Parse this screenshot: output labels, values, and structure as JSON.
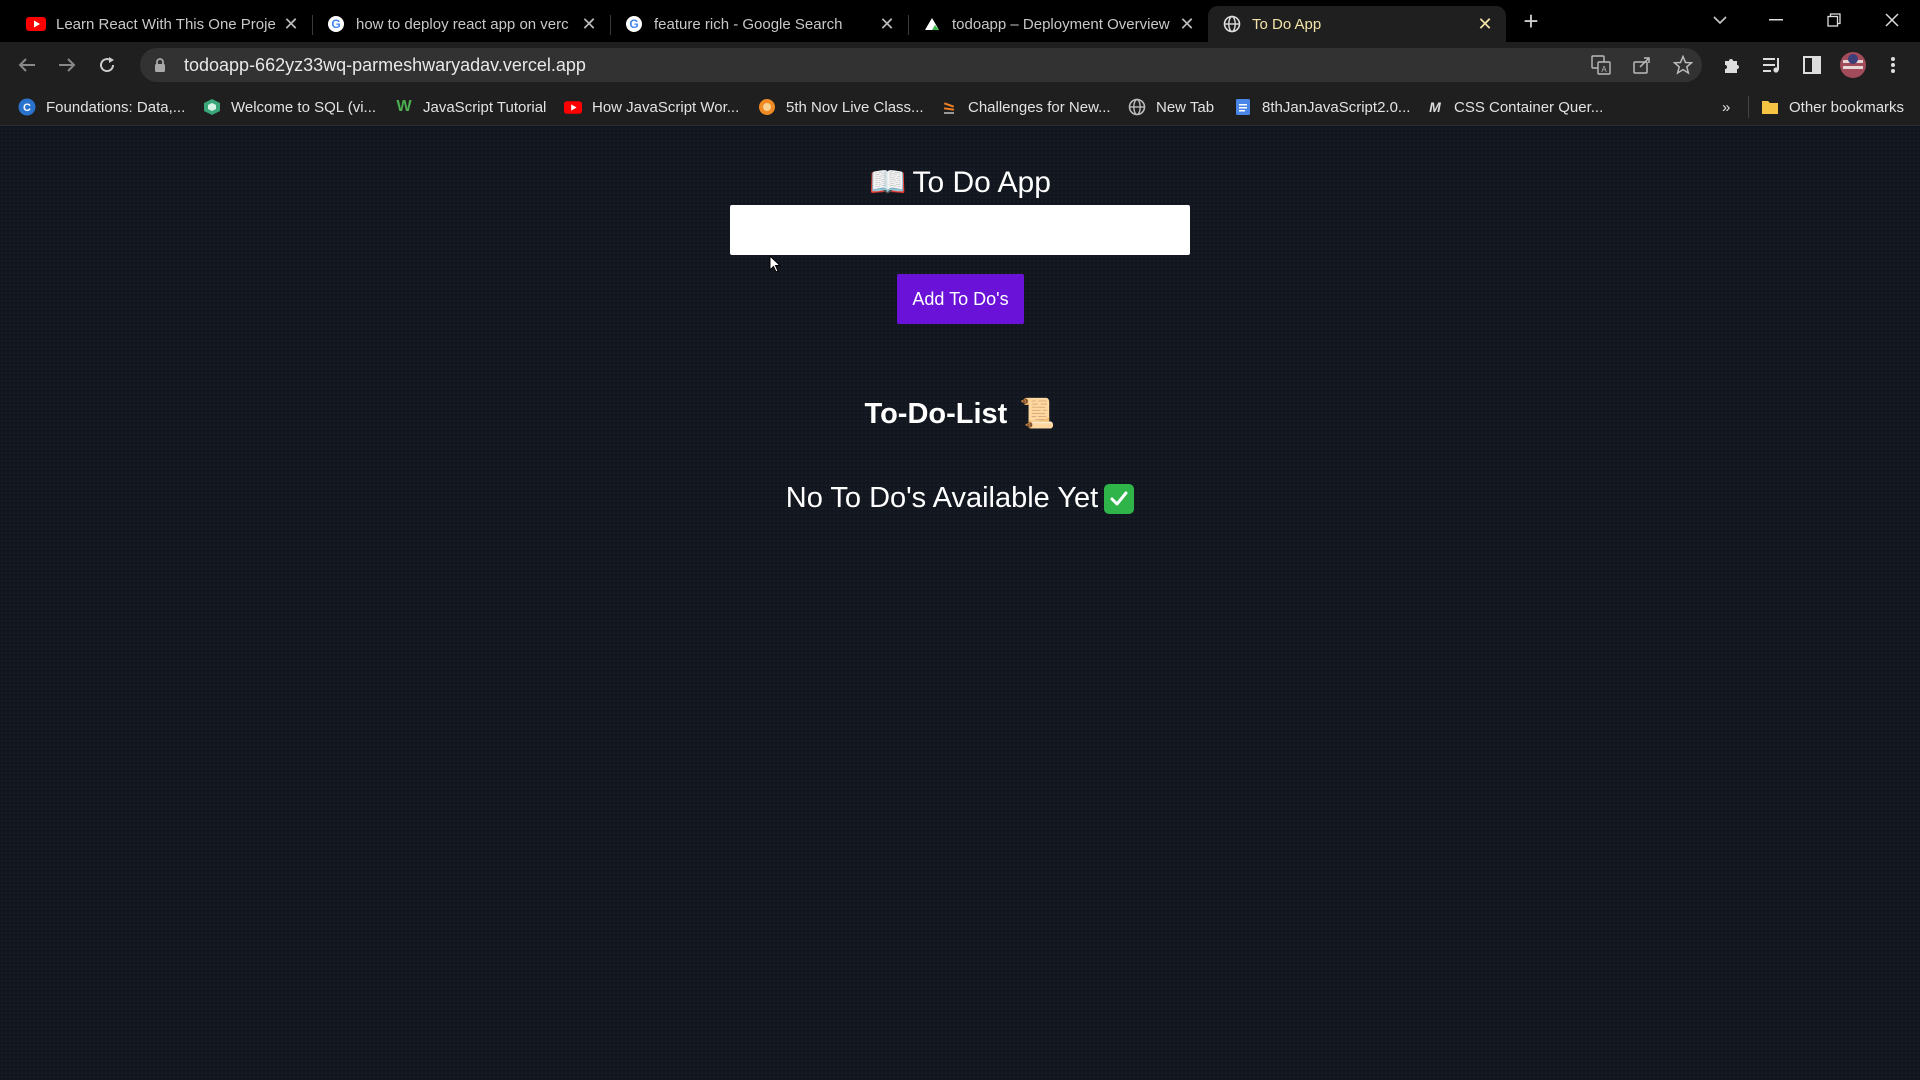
{
  "browser": {
    "tabs": [
      {
        "title": "Learn React With This One Projec",
        "icon": "youtube-icon"
      },
      {
        "title": "how to deploy react app on verc",
        "icon": "google-icon"
      },
      {
        "title": "feature rich - Google Search",
        "icon": "google-icon"
      },
      {
        "title": "todoapp – Deployment Overview",
        "icon": "vercel-icon"
      },
      {
        "title": "To Do App",
        "icon": "globe-icon",
        "active": true
      }
    ],
    "url": "todoapp-662yz33wq-parmeshwaryadav.vercel.app",
    "bookmarks": [
      {
        "label": "Foundations: Data,...",
        "icon": "coursera-icon"
      },
      {
        "label": "Welcome to SQL (vi...",
        "icon": "cube-icon"
      },
      {
        "label": "JavaScript Tutorial",
        "icon": "w3-icon"
      },
      {
        "label": "How JavaScript Wor...",
        "icon": "youtube-icon"
      },
      {
        "label": "5th Nov Live Class...",
        "icon": "orange-circle-icon"
      },
      {
        "label": "Challenges for New...",
        "icon": "stack-icon"
      },
      {
        "label": "New Tab",
        "icon": "globe-icon"
      },
      {
        "label": "8thJanJavaScript2.0...",
        "icon": "docs-icon"
      },
      {
        "label": "CSS Container Quer...",
        "icon": "medium-icon"
      }
    ],
    "other_bookmarks": "Other bookmarks",
    "bookmarks_overflow": "»"
  },
  "app": {
    "title": "To Do App",
    "title_emoji": "📖",
    "input_value": "",
    "add_button": "Add To Do's",
    "list_title": "To-Do-List",
    "list_emoji": "📜",
    "empty_message": "No To Do's Available Yet",
    "empty_check": "✔"
  },
  "colors": {
    "page_bg": "#11161f",
    "button": "#6a12d8",
    "check": "#2fb44a",
    "active_tab_text": "#f3e3a8"
  }
}
